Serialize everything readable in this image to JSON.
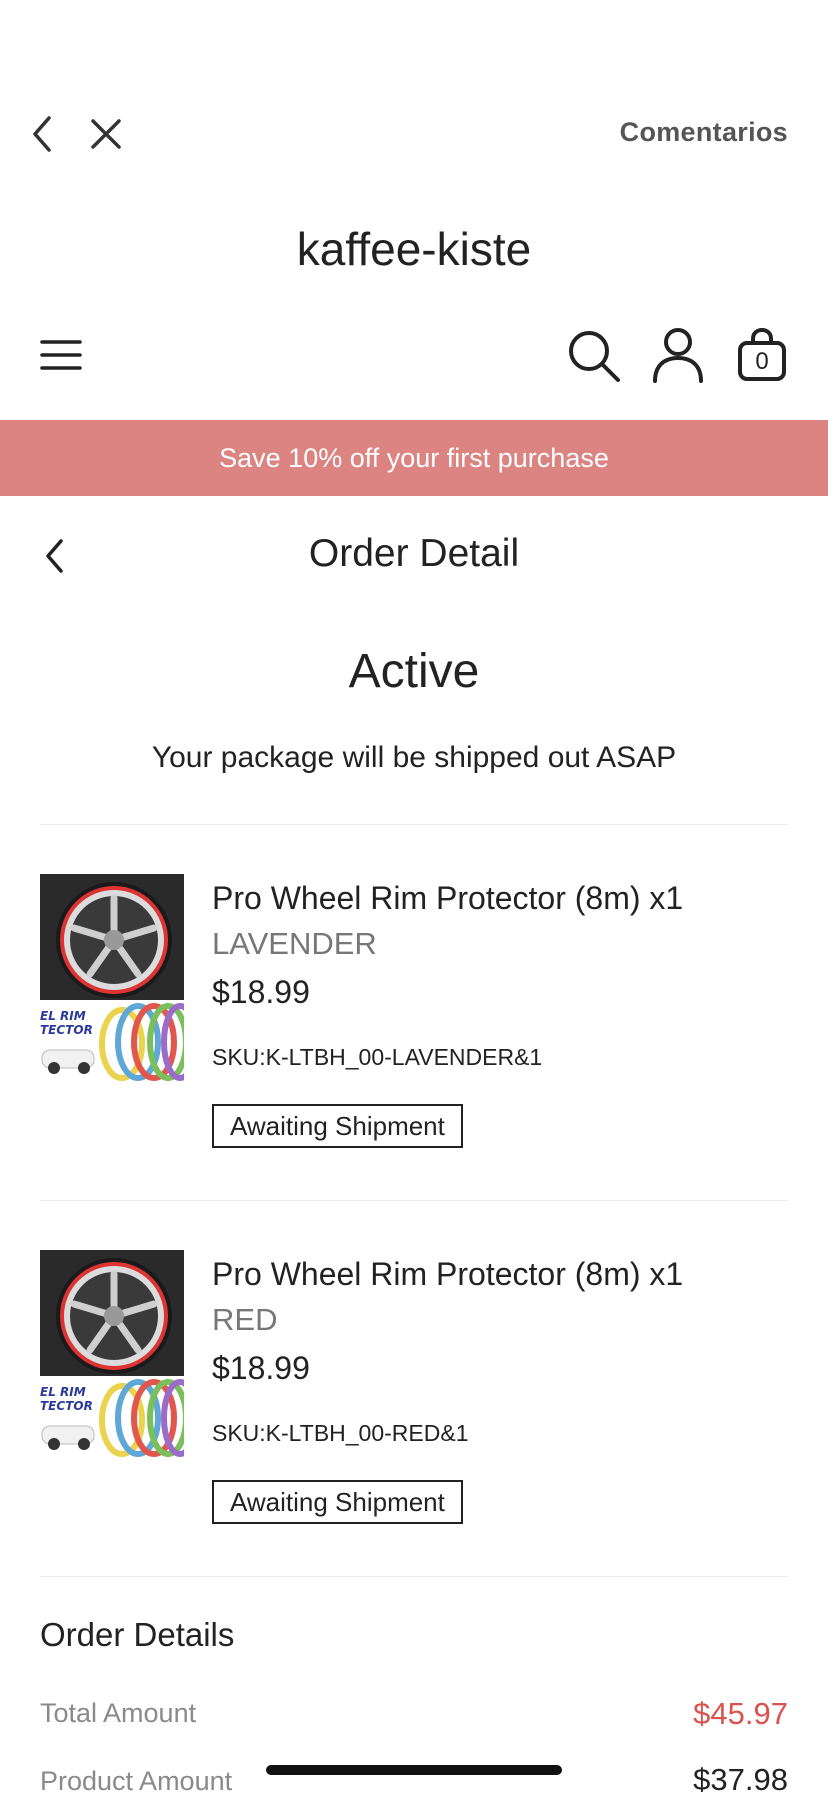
{
  "topbar": {
    "comments_label": "Comentarios"
  },
  "header": {
    "store_name": "kaffee-kiste",
    "cart_count": "0"
  },
  "banner": {
    "text": "Save 10% off your first purchase",
    "bg_color": "#DC8482"
  },
  "page": {
    "title": "Order Detail",
    "status": "Active",
    "status_message": "Your package will be shipped out ASAP"
  },
  "items": [
    {
      "name": "Pro Wheel Rim Protector (8m) x1",
      "variant": "LAVENDER",
      "price": "$18.99",
      "sku": "SKU:K-LTBH_00-LAVENDER&1",
      "status": "Awaiting Shipment",
      "thumb_text": "EL RIM\nTECTOR"
    },
    {
      "name": "Pro Wheel Rim Protector (8m) x1",
      "variant": "RED",
      "price": "$18.99",
      "sku": "SKU:K-LTBH_00-RED&1",
      "status": "Awaiting Shipment",
      "thumb_text": "EL RIM\nTECTOR"
    }
  ],
  "order_details": {
    "title": "Order Details",
    "rows": [
      {
        "label": "Total Amount",
        "value": "$45.97",
        "value_color": "#D9534F"
      },
      {
        "label": "Product Amount",
        "value": "$37.98",
        "value_color": "#222222"
      }
    ]
  }
}
